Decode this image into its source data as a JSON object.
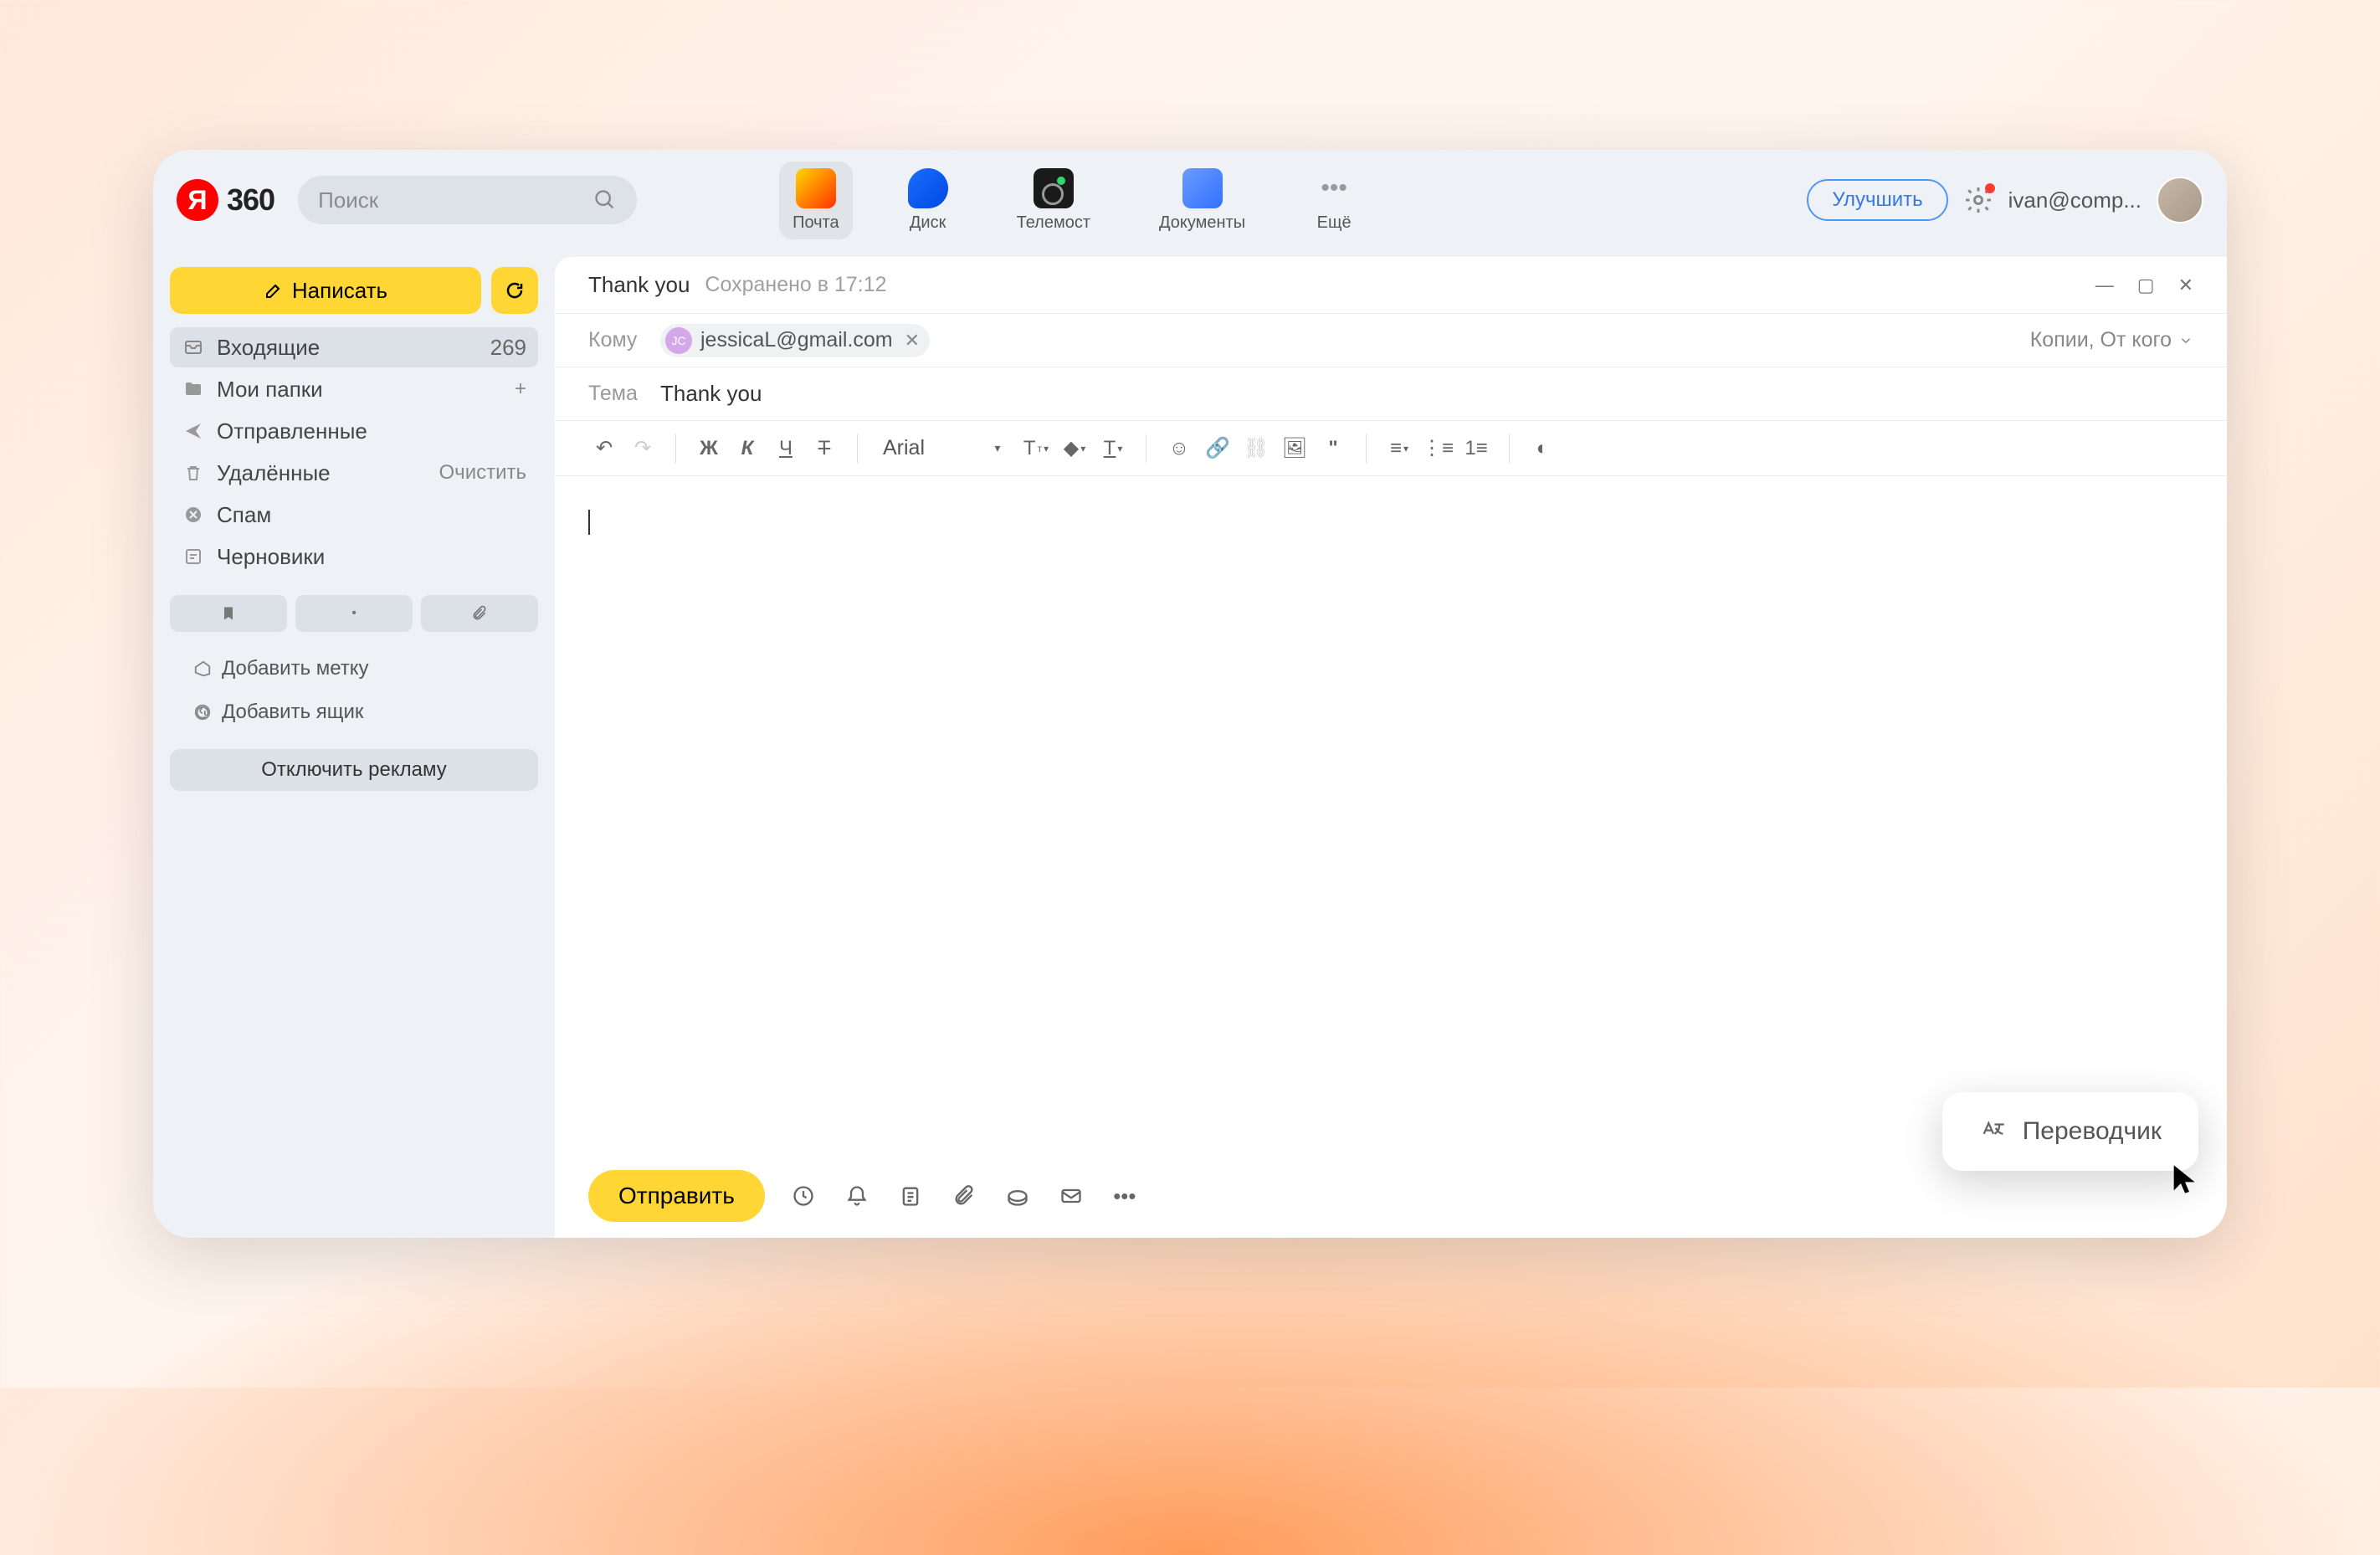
{
  "brand": {
    "letter": "Я",
    "number": "360"
  },
  "search": {
    "placeholder": "Поиск"
  },
  "appTabs": {
    "mail": "Почта",
    "disk": "Диск",
    "telemost": "Телемост",
    "docs": "Документы",
    "more": "Ещё"
  },
  "header": {
    "improve": "Улучшить",
    "email": "ivan@comp..."
  },
  "sidebar": {
    "compose": "Написать",
    "folders": {
      "inbox": {
        "label": "Входящие",
        "count": "269"
      },
      "myFolders": {
        "label": "Мои папки"
      },
      "sent": {
        "label": "Отправленные"
      },
      "trash": {
        "label": "Удалённые",
        "action": "Очистить"
      },
      "spam": {
        "label": "Спам"
      },
      "drafts": {
        "label": "Черновики"
      }
    },
    "addLabel": "Добавить метку",
    "addMailbox": "Добавить ящик",
    "adsOff": "Отключить рекламу"
  },
  "compose": {
    "title": "Thank you",
    "savedAt": "Сохранено в 17:12",
    "toLabel": "Кому",
    "recipient": {
      "avatar": "JC",
      "email": "jessicaL@gmail.com"
    },
    "ccLabel": "Копии, От кого",
    "subjectLabel": "Тема",
    "subject": "Thank you",
    "font": "Arial",
    "send": "Отправить"
  },
  "translator": {
    "label": "Переводчик"
  }
}
